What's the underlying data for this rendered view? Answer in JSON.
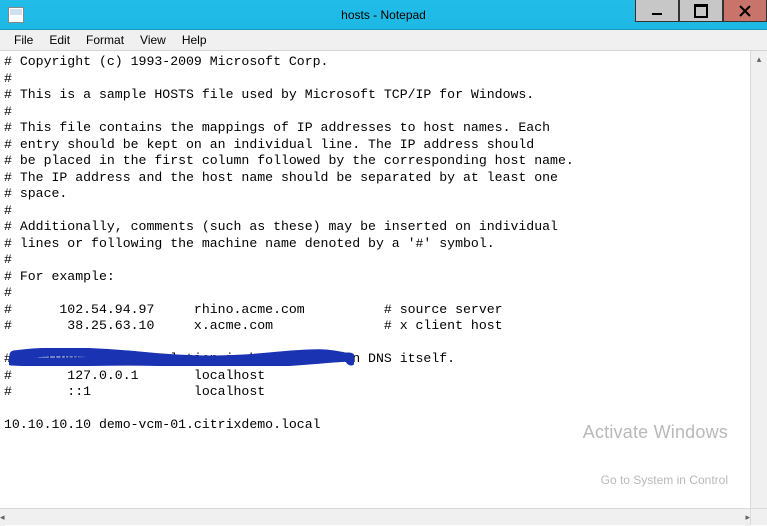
{
  "window": {
    "title": "hosts - Notepad"
  },
  "menu": {
    "file": "File",
    "edit": "Edit",
    "format": "Format",
    "view": "View",
    "help": "Help"
  },
  "document": {
    "lines": [
      "# Copyright (c) 1993-2009 Microsoft Corp.",
      "#",
      "# This is a sample HOSTS file used by Microsoft TCP/IP for Windows.",
      "#",
      "# This file contains the mappings of IP addresses to host names. Each",
      "# entry should be kept on an individual line. The IP address should",
      "# be placed in the first column followed by the corresponding host name.",
      "# The IP address and the host name should be separated by at least one",
      "# space.",
      "#",
      "# Additionally, comments (such as these) may be inserted on individual",
      "# lines or following the machine name denoted by a '#' symbol.",
      "#",
      "# For example:",
      "#",
      "#      102.54.94.97     rhino.acme.com          # source server",
      "#       38.25.63.10     x.acme.com              # x client host",
      "",
      "# localhost name resolution is handled within DNS itself.",
      "#       127.0.0.1       localhost",
      "#       ::1             localhost",
      "",
      "10.10.10.10 demo-vcm-01.citrixdemo.local"
    ]
  },
  "watermark": {
    "line1": "Activate Windows",
    "line2": "Go to System in Control"
  }
}
